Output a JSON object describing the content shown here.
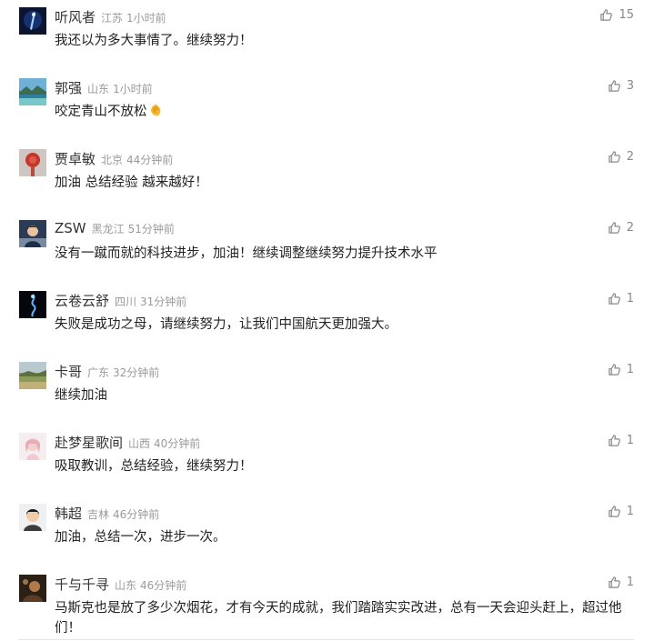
{
  "comments": [
    {
      "nickname": "听风者",
      "location": "江苏",
      "time": "1小时前",
      "text": "我还以为多大事情了。继续努力！",
      "likes": "15"
    },
    {
      "nickname": "郭强",
      "location": "山东",
      "time": "1小时前",
      "text": "咬定青山不放松",
      "likes": "3",
      "emoji": "clapping-hands"
    },
    {
      "nickname": "贾卓敏",
      "location": "北京",
      "time": "44分钟前",
      "text": "加油 总结经验 越来越好！",
      "likes": "2"
    },
    {
      "nickname": "ZSW",
      "location": "黑龙江",
      "time": "51分钟前",
      "text": "没有一蹴而就的科技进步，加油！继续调整继续努力提升技术水平",
      "likes": "2"
    },
    {
      "nickname": "云卷云舒",
      "location": "四川",
      "time": "31分钟前",
      "text": "失败是成功之母，请继续努力，让我们中国航天更加强大。",
      "likes": "1"
    },
    {
      "nickname": "卡哥",
      "location": "广东",
      "time": "32分钟前",
      "text": "继续加油",
      "likes": "1"
    },
    {
      "nickname": "赴梦星歌间",
      "location": "山西",
      "time": "40分钟前",
      "text": "吸取教训，总结经验，继续努力！",
      "likes": "1"
    },
    {
      "nickname": "韩超",
      "location": "吉林",
      "time": "46分钟前",
      "text": "加油，总结一次，进步一次。",
      "likes": "1"
    },
    {
      "nickname": "千与千寻",
      "location": "山东",
      "time": "46分钟前",
      "text": "马斯克也是放了多少次烟花，才有今天的成就，我们踏踏实实改进，总有一天会迎头赶上，超过他们！",
      "likes": "1"
    }
  ],
  "icons": {
    "like": "thumbs-up-icon",
    "emoji": "clapping-hands-icon"
  },
  "colors": {
    "nickname": "#333333",
    "meta": "#9a9a9a",
    "text": "#222222",
    "like": "#888888"
  }
}
